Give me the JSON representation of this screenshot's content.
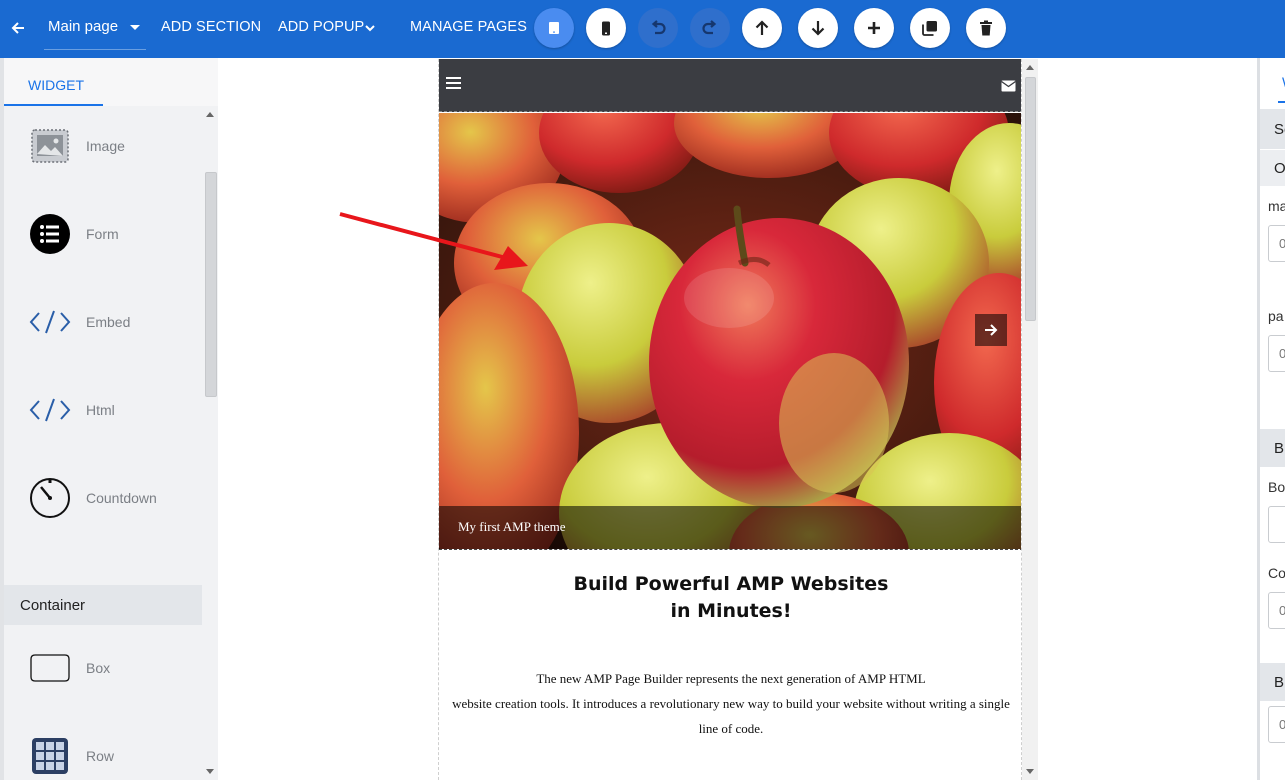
{
  "toolbar": {
    "page_name": "Main page",
    "add_section": "ADD SECTION",
    "add_popup": "ADD POPUP",
    "manage_pages": "MANAGE PAGES",
    "buttons": [
      "desktop-view",
      "mobile-view",
      "undo",
      "redo",
      "move-up",
      "move-down",
      "add",
      "duplicate",
      "delete"
    ]
  },
  "left_panel": {
    "tab": "WIDGET",
    "widgets": [
      {
        "label": "Image",
        "icon": "image-icon"
      },
      {
        "label": "Form",
        "icon": "form-list-icon"
      },
      {
        "label": "Embed",
        "icon": "code-icon"
      },
      {
        "label": "Html",
        "icon": "code-icon"
      },
      {
        "label": "Countdown",
        "icon": "timer-icon"
      }
    ],
    "container_heading": "Container",
    "containers": [
      {
        "label": "Box",
        "icon": "box-icon"
      },
      {
        "label": "Row",
        "icon": "grid-icon"
      }
    ]
  },
  "canvas": {
    "carousel_caption": "My first AMP theme",
    "hero_title_line1": "Build Powerful AMP Websites",
    "hero_title_line2": "in Minutes!",
    "hero_body_line1": "The new AMP Page Builder represents the next generation of AMP HTML",
    "hero_body_line2": "website creation tools. It introduces a revolutionary new way to build your website without writing a single",
    "hero_body_line3": "line of code."
  },
  "right_panel": {
    "tab": "W",
    "band1": "Se",
    "band2": "O",
    "label1": "ma",
    "input1": "0",
    "label2": "pa",
    "input2": "0",
    "band3": "B",
    "label3": "Bo",
    "label4": "Co",
    "input4": "0",
    "band4": "B",
    "input5": "0"
  },
  "colors": {
    "toolbar": "#1a6ad1",
    "accent": "#1a73e8",
    "annotation_arrow": "#e8161b"
  }
}
